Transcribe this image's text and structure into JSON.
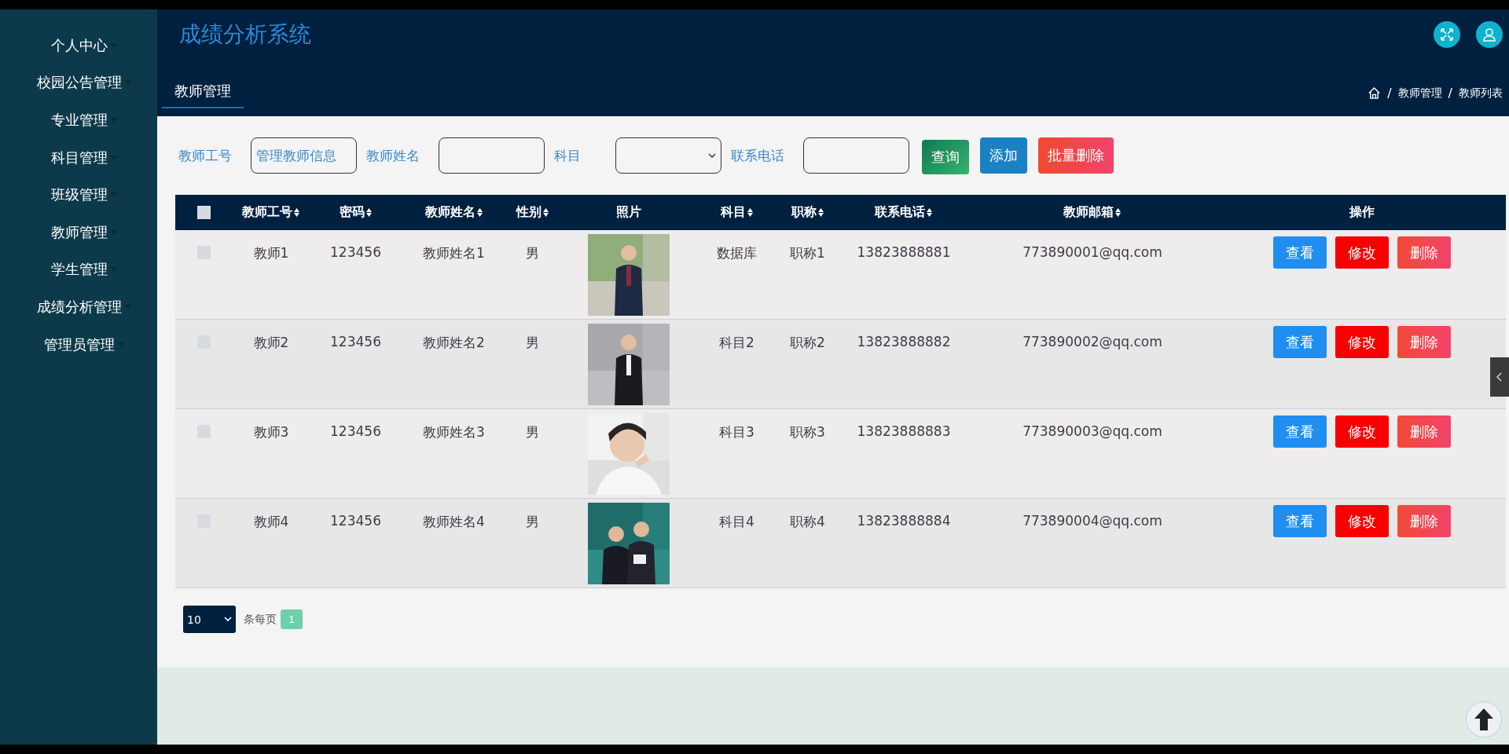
{
  "sidebar": {
    "items": [
      {
        "label": "个人中心"
      },
      {
        "label": "校园公告管理"
      },
      {
        "label": "专业管理"
      },
      {
        "label": "科目管理"
      },
      {
        "label": "班级管理"
      },
      {
        "label": "教师管理"
      },
      {
        "label": "学生管理"
      },
      {
        "label": "成绩分析管理"
      },
      {
        "label": "管理员管理"
      }
    ]
  },
  "header": {
    "title": "成绩分析系统",
    "tabs": [
      {
        "label": "教师管理",
        "selected": true
      }
    ],
    "breadcrumb": [
      {
        "kind": "separator",
        "text": "/"
      },
      {
        "kind": "link",
        "text": "教师管理"
      },
      {
        "kind": "separator",
        "text": "/"
      },
      {
        "kind": "link",
        "text": "教师列表"
      }
    ]
  },
  "filters": [
    {
      "kind": "text",
      "label": "教师工号",
      "value": "管理教师信息"
    },
    {
      "kind": "text",
      "label": "教师姓名"
    },
    {
      "kind": "select",
      "label": "科目"
    },
    {
      "kind": "text",
      "label": "联系电话"
    }
  ],
  "filter_buttons": [
    {
      "kind": "query",
      "label": "查询"
    },
    {
      "kind": "add",
      "label": "添加"
    },
    {
      "kind": "batch-delete",
      "label": "批量删除"
    }
  ],
  "table": {
    "select_all": {
      "checked": false
    },
    "columns": [
      {
        "label": "教师工号",
        "sortable": true
      },
      {
        "label": "密码",
        "sortable": true
      },
      {
        "label": "教师姓名",
        "sortable": true
      },
      {
        "label": "性别",
        "sortable": true
      },
      {
        "label": "照片",
        "sortable": false
      },
      {
        "label": "科目",
        "sortable": true
      },
      {
        "label": "职称",
        "sortable": true
      },
      {
        "label": "联系电话",
        "sortable": true
      },
      {
        "label": "教师邮箱",
        "sortable": true
      },
      {
        "label": "操作",
        "sortable": false
      }
    ],
    "rows": [
      {
        "checked": false,
        "cells": [
          "教师1",
          "123456",
          "教师姓名1",
          "男",
          {
            "kind": "picture"
          },
          "数据库",
          "职称1",
          "13823888881",
          "773890001@qq.com"
        ],
        "actions": [
          {
            "kind": "view",
            "label": "查看"
          },
          {
            "kind": "edit",
            "label": "修改"
          },
          {
            "kind": "delete",
            "label": "删除"
          }
        ]
      },
      {
        "checked": false,
        "cells": [
          "教师2",
          "123456",
          "教师姓名2",
          "男",
          {
            "kind": "picture"
          },
          "科目2",
          "职称2",
          "13823888882",
          "773890002@qq.com"
        ],
        "actions": [
          {
            "kind": "view",
            "label": "查看"
          },
          {
            "kind": "edit",
            "label": "修改"
          },
          {
            "kind": "delete",
            "label": "删除"
          }
        ]
      },
      {
        "checked": false,
        "cells": [
          "教师3",
          "123456",
          "教师姓名3",
          "男",
          {
            "kind": "picture"
          },
          "科目3",
          "职称3",
          "13823888883",
          "773890003@qq.com"
        ],
        "actions": [
          {
            "kind": "view",
            "label": "查看"
          },
          {
            "kind": "edit",
            "label": "修改"
          },
          {
            "kind": "delete",
            "label": "删除"
          }
        ]
      },
      {
        "checked": false,
        "cells": [
          "教师4",
          "123456",
          "教师姓名4",
          "男",
          {
            "kind": "picture"
          },
          "科目4",
          "职称4",
          "13823888884",
          "773890004@qq.com"
        ],
        "actions": [
          {
            "kind": "view",
            "label": "查看"
          },
          {
            "kind": "edit",
            "label": "修改"
          },
          {
            "kind": "delete",
            "label": "删除"
          }
        ]
      }
    ]
  },
  "pagination": {
    "page_size": "10",
    "per_page_label": "条每页",
    "pages": [
      {
        "label": "1",
        "selected": true
      }
    ]
  }
}
